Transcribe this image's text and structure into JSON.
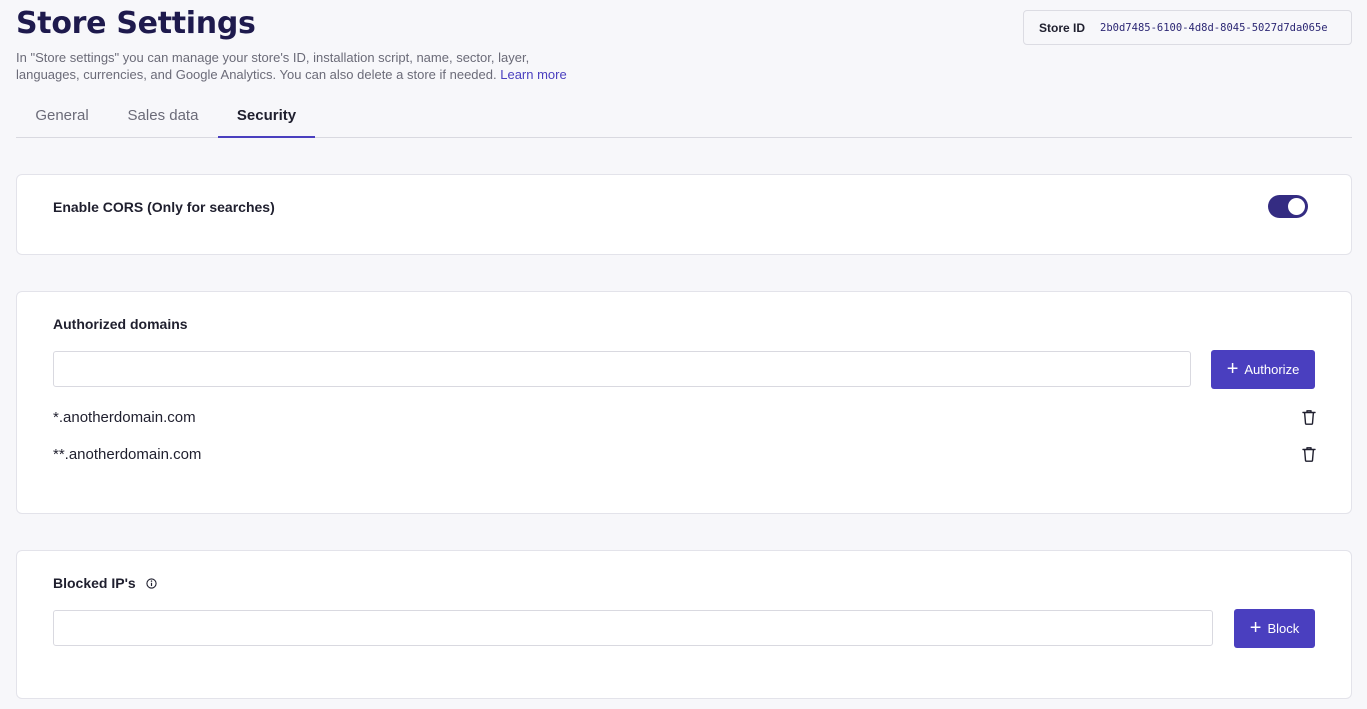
{
  "page": {
    "title": "Store Settings",
    "description": "In \"Store settings\" you can manage your store's ID, installation script, name, sector, layer, languages, currencies, and Google Analytics. You can also delete a store if needed.",
    "learn_more": "Learn more"
  },
  "store_id": {
    "label": "Store ID",
    "value": "2b0d7485-6100-4d8d-8045-5027d7da065e"
  },
  "tabs": [
    {
      "label": "General",
      "active": false
    },
    {
      "label": "Sales data",
      "active": false
    },
    {
      "label": "Security",
      "active": true
    }
  ],
  "cors": {
    "label": "Enable CORS (Only for searches)",
    "enabled": true
  },
  "authorized_domains": {
    "title": "Authorized domains",
    "input_value": "",
    "button_label": "Authorize",
    "domains": [
      "*.anotherdomain.com",
      "**.anotherdomain.com"
    ]
  },
  "blocked_ips": {
    "title": "Blocked IP's",
    "input_value": "",
    "button_label": "Block"
  },
  "colors": {
    "accent": "#4a3fbf",
    "toggle_on": "#342c82",
    "title": "#1e1a4d"
  }
}
